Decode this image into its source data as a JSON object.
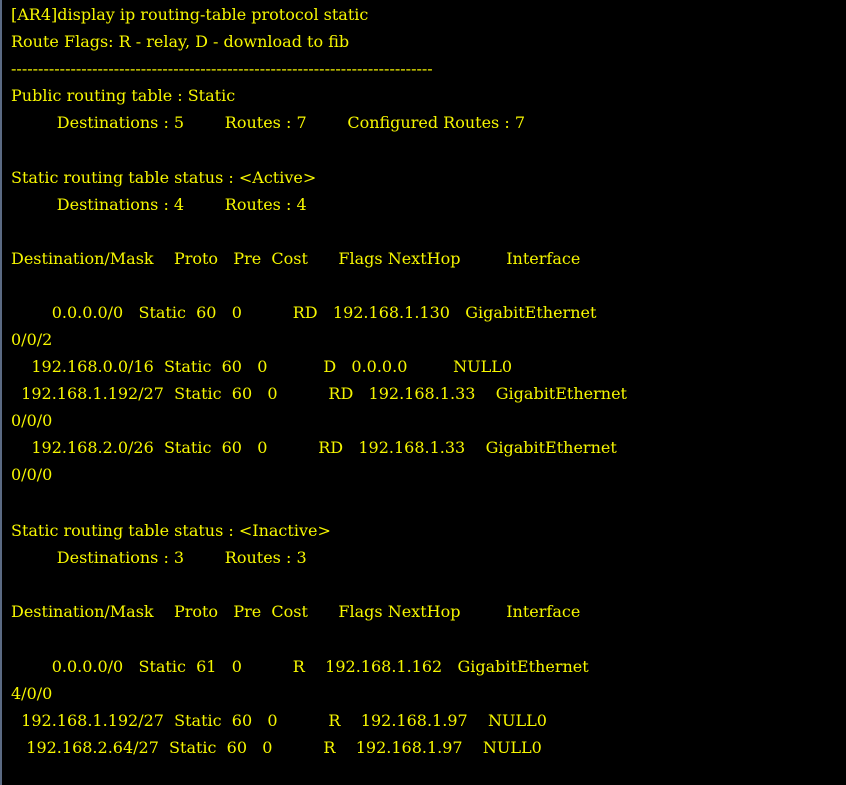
{
  "terminal": {
    "text_color": "#f6f600",
    "background_color": "#000000",
    "lines": [
      "[AR4]display ip routing-table protocol static",
      "Route Flags: R - relay, D - download to fib",
      "------------------------------------------------------------------------------",
      "Public routing table : Static",
      "         Destinations : 5        Routes : 7        Configured Routes : 7",
      "Static routing table status : <Active>",
      "         Destinations : 4        Routes : 4",
      "Destination/Mask    Proto   Pre  Cost      Flags NextHop         Interface",
      "        0.0.0.0/0   Static  60   0          RD   192.168.1.130   GigabitEthernet",
      "0/0/2",
      "    192.168.0.0/16  Static  60   0           D   0.0.0.0         NULL0",
      "  192.168.1.192/27  Static  60   0          RD   192.168.1.33    GigabitEthernet",
      "0/0/0",
      "    192.168.2.0/26  Static  60   0          RD   192.168.1.33    GigabitEthernet",
      "0/0/0",
      "Static routing table status : <Inactive>",
      "         Destinations : 3        Routes : 3",
      "Destination/Mask    Proto   Pre  Cost      Flags NextHop         Interface",
      "        0.0.0.0/0   Static  61   0          R    192.168.1.162   GigabitEthernet",
      "4/0/0",
      "  192.168.1.192/27  Static  60   0          R    192.168.1.97    NULL0",
      "   192.168.2.64/27  Static  60   0          R    192.168.1.97    NULL0"
    ]
  }
}
